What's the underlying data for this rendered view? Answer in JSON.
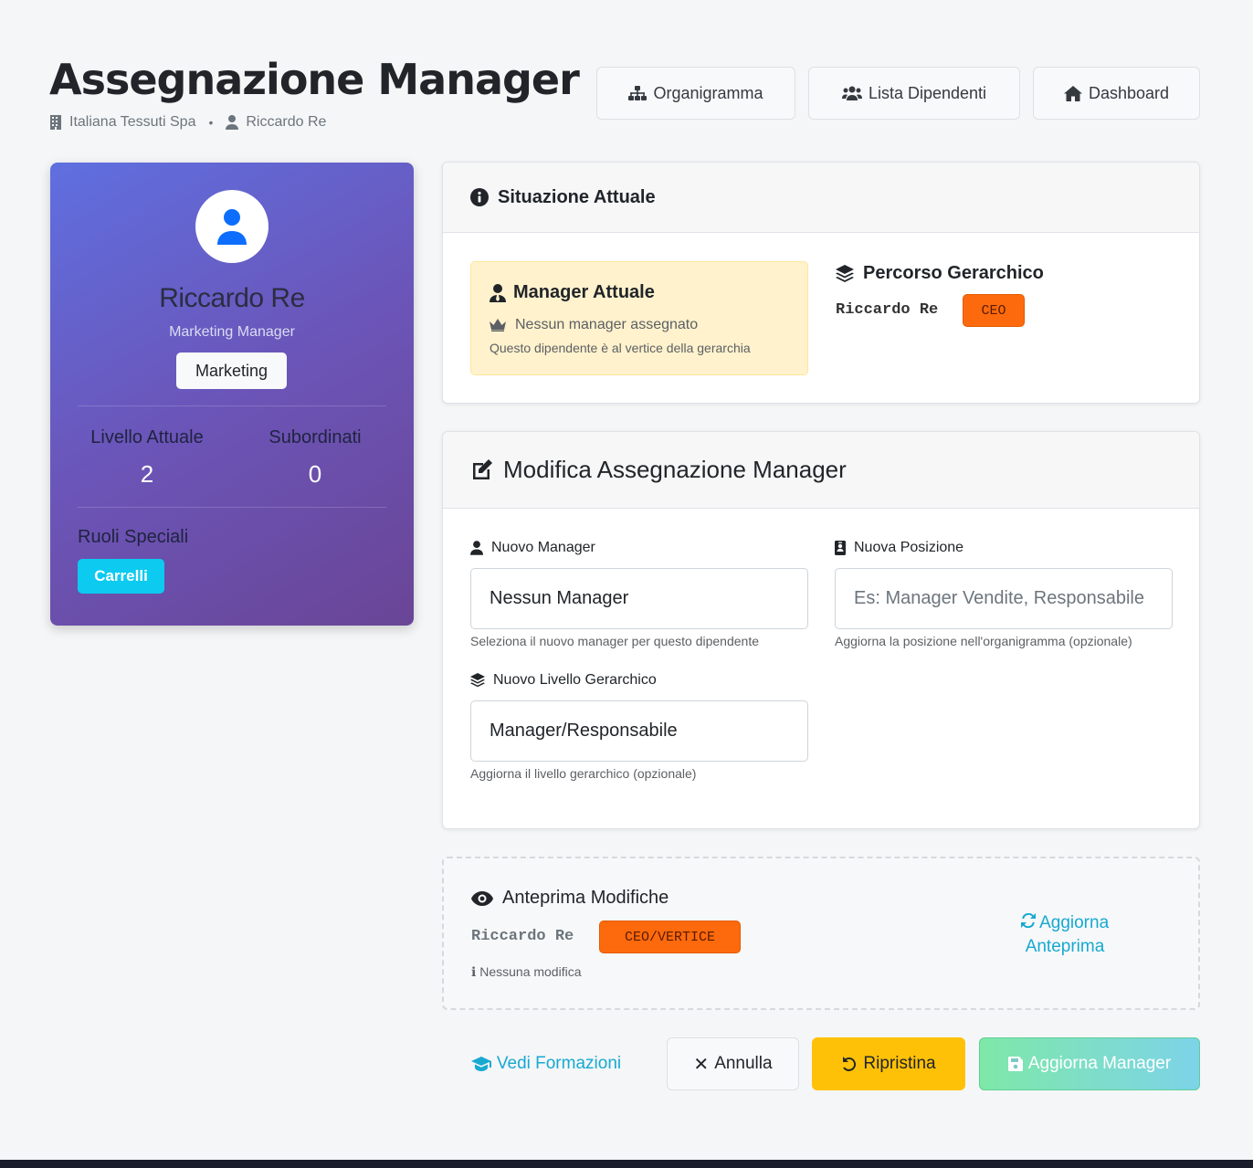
{
  "header": {
    "title": "Assegnazione Manager",
    "company": "Italiana Tessuti Spa",
    "separator": "•",
    "user": "Riccardo Re",
    "nav": {
      "org_chart": "Organigramma",
      "employees": "Lista Dipendenti",
      "dashboard": "Dashboard"
    }
  },
  "profile": {
    "name": "Riccardo Re",
    "role": "Marketing Manager",
    "department": "Marketing",
    "stats": {
      "level_label": "Livello Attuale",
      "level_value": "2",
      "subordinates_label": "Subordinati",
      "subordinates_value": "0"
    },
    "special_roles_label": "Ruoli Speciali",
    "special_roles": [
      "Carrelli"
    ]
  },
  "current": {
    "title": "Situazione Attuale",
    "manager_title": "Manager Attuale",
    "manager_value": "Nessun manager assegnato",
    "manager_note": "Questo dipendente è al vertice della gerarchia",
    "path_title": "Percorso Gerarchico",
    "path_name": "Riccardo Re",
    "path_badge": "CEO"
  },
  "form": {
    "title": "Modifica Assegnazione Manager",
    "manager_label": "Nuovo Manager",
    "manager_value": "Nessun Manager",
    "manager_hint": "Seleziona il nuovo manager per questo dipendente",
    "position_label": "Nuova Posizione",
    "position_placeholder": "Es: Manager Vendite, Responsabile",
    "position_hint": "Aggiorna la posizione nell'organigramma (opzionale)",
    "level_label": "Nuovo Livello Gerarchico",
    "level_value": "Manager/Responsabile",
    "level_hint": "Aggiorna il livello gerarchico (opzionale)"
  },
  "preview": {
    "title": "Anteprima Modifiche",
    "name": "Riccardo Re",
    "badge": "CEO/VERTICE",
    "note": "Nessuna modifica",
    "refresh_line1": "Aggiorna",
    "refresh_line2": "Anteprima"
  },
  "actions": {
    "trainings": "Vedi Formazioni",
    "cancel": "Annulla",
    "reset": "Ripristina",
    "submit": "Aggiorna Manager"
  },
  "colors": {
    "accent_cyan": "#0dcaf0",
    "warning": "#ffc107",
    "orange_badge": "#fd6a0d",
    "success_gradient_start": "#7ee8a8",
    "success_gradient_end": "#7dd3e8"
  }
}
